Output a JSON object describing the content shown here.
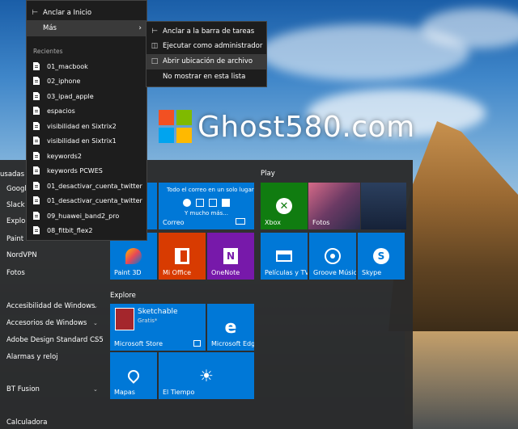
{
  "watermark": {
    "text": "Ghost580.com"
  },
  "context_menu": {
    "pin_start": "Anclar a Inicio",
    "more": "Más",
    "recent_header": "Recientes",
    "recent_items": [
      "01_macbook",
      "02_iphone",
      "03_ipad_apple",
      "espacios",
      "visibilidad en Sixtrix2",
      "visibilidad en Sixtrix1",
      "keywords2",
      "keywords PCWES",
      "01_desactivar_cuenta_twitter",
      "01_desactivar_cuenta_twitter",
      "09_huawei_band2_pro",
      "08_fitbit_flex2"
    ]
  },
  "submenu": {
    "items": [
      "Anclar a la barra de tareas",
      "Ejecutar como administrador",
      "Abrir ubicación de archivo",
      "No mostrar en esta lista"
    ]
  },
  "app_list": {
    "header": "usadas",
    "items": [
      "Google",
      "Slack",
      "Explorac",
      "Paint",
      "NordVPN",
      "Fotos"
    ],
    "folders": [
      "Accesibilidad de Windows",
      "Accesorios de Windows",
      "Adobe Design Standard CS5",
      "Alarmas y reloj",
      "BT Fusion",
      "Calculadora"
    ]
  },
  "tiles": {
    "section_play": "Play",
    "section_explore": "Explore",
    "mail_header": "Todo el correo en un solo lugar",
    "mail_more": "Y mucho más...",
    "mail": "Correo",
    "xbox": "Xbox",
    "photos": "Fotos",
    "paint3d": "Paint 3D",
    "office": "Mi Office",
    "onenote": "OneNote",
    "movies": "Películas y TV",
    "groove": "Groove Música",
    "skype": "Skype",
    "sketchable": "Sketchable",
    "sketchable_sub": "Gratis*",
    "store": "Microsoft Store",
    "edge": "Microsoft Edge",
    "maps": "Mapas",
    "weather": "El Tiempo"
  },
  "colors": {
    "tile_blue": "#0078d7",
    "tile_green": "#107c10",
    "tile_orange": "#d83b01",
    "tile_purple": "#7719aa"
  }
}
